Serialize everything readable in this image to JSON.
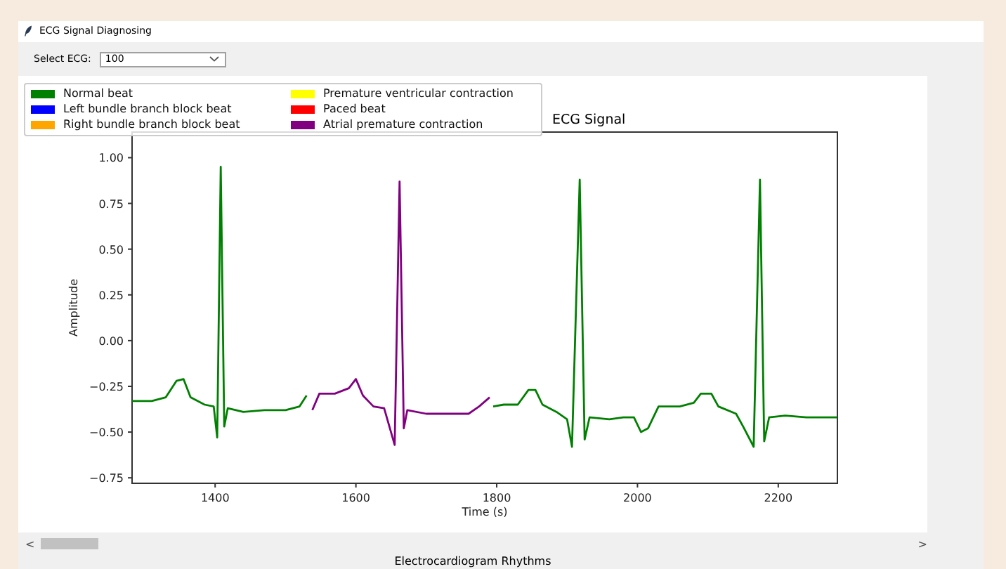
{
  "window": {
    "title": "ECG Signal Diagnosing"
  },
  "toolbar": {
    "label": "Select ECG:",
    "select": {
      "value": "100"
    }
  },
  "plot": {
    "legend": [
      {
        "label": "Normal beat",
        "color": "#008000"
      },
      {
        "label": "Left bundle branch block beat",
        "color": "#0000ff"
      },
      {
        "label": "Right bundle branch block beat",
        "color": "#ffa500"
      },
      {
        "label": "Premature ventricular contraction",
        "color": "#ffff00"
      },
      {
        "label": "Paced beat",
        "color": "#ff0000"
      },
      {
        "label": "Atrial premature contraction",
        "color": "#800080"
      }
    ],
    "chart_data": {
      "type": "line",
      "title": "ECG Signal",
      "xlabel": "Time (s)",
      "ylabel": "Amplitude",
      "x": [
        1282,
        1310,
        1330,
        1345,
        1355,
        1365,
        1385,
        1398,
        1403,
        1408,
        1413,
        1418,
        1440,
        1470,
        1500,
        1520,
        1530,
        1538,
        1548,
        1570,
        1590,
        1600,
        1610,
        1625,
        1640,
        1655,
        1662,
        1668,
        1673,
        1700,
        1740,
        1760,
        1775,
        1790,
        1795,
        1810,
        1830,
        1845,
        1855,
        1865,
        1885,
        1900,
        1907,
        1918,
        1925,
        1932,
        1960,
        1980,
        1995,
        2005,
        2015,
        2030,
        2060,
        2080,
        2090,
        2105,
        2115,
        2140,
        2150,
        2165,
        2174,
        2180,
        2187,
        2210,
        2240,
        2284
      ],
      "series": [
        {
          "color": "#008000",
          "values": [
            -0.33,
            -0.33,
            -0.31,
            -0.22,
            -0.21,
            -0.31,
            -0.35,
            -0.36,
            -0.53,
            0.95,
            -0.47,
            -0.37,
            -0.39,
            -0.38,
            -0.38,
            -0.36,
            -0.3,
            null,
            null,
            null,
            null,
            null,
            null,
            null,
            null,
            null,
            null,
            null,
            null,
            null,
            null,
            null,
            null,
            null,
            -0.36,
            -0.35,
            -0.35,
            -0.27,
            -0.27,
            -0.35,
            -0.39,
            -0.43,
            -0.58,
            0.88,
            -0.54,
            -0.42,
            -0.43,
            -0.42,
            -0.42,
            -0.5,
            -0.48,
            -0.36,
            -0.36,
            -0.34,
            -0.29,
            -0.29,
            -0.36,
            -0.4,
            -0.47,
            -0.58,
            0.88,
            -0.55,
            -0.42,
            -0.41,
            -0.42,
            -0.42
          ]
        },
        {
          "color": "#800080",
          "values": [
            null,
            null,
            null,
            null,
            null,
            null,
            null,
            null,
            null,
            null,
            null,
            null,
            null,
            null,
            null,
            null,
            null,
            -0.38,
            -0.29,
            -0.29,
            -0.26,
            -0.21,
            -0.3,
            -0.36,
            -0.37,
            -0.57,
            0.87,
            -0.48,
            -0.38,
            -0.4,
            -0.4,
            -0.4,
            -0.36,
            -0.31,
            null,
            null,
            null,
            null,
            null,
            null,
            null,
            null,
            null,
            null,
            null,
            null,
            null,
            null,
            null,
            null,
            null,
            null,
            null,
            null,
            null,
            null,
            null,
            null,
            null,
            null,
            null,
            null,
            null,
            null,
            null,
            null
          ]
        }
      ],
      "xlim": [
        1282,
        2284
      ],
      "ylim": [
        -0.78,
        1.14
      ],
      "xticks": [
        1400,
        1600,
        1800,
        2000,
        2200
      ],
      "yticks": [
        {
          "value": -0.75,
          "label": "−0.75"
        },
        {
          "value": -0.5,
          "label": "−0.50"
        },
        {
          "value": -0.25,
          "label": "−0.25"
        },
        {
          "value": 0,
          "label": "0.00"
        },
        {
          "value": 0.25,
          "label": "0.25"
        },
        {
          "value": 0.5,
          "label": "0.50"
        },
        {
          "value": 0.75,
          "label": "0.75"
        },
        {
          "value": 1,
          "label": "1.00"
        }
      ]
    }
  },
  "scrollbar": {
    "left": "<",
    "right": ">"
  },
  "caption": "Electrocardiogram Rhythms"
}
